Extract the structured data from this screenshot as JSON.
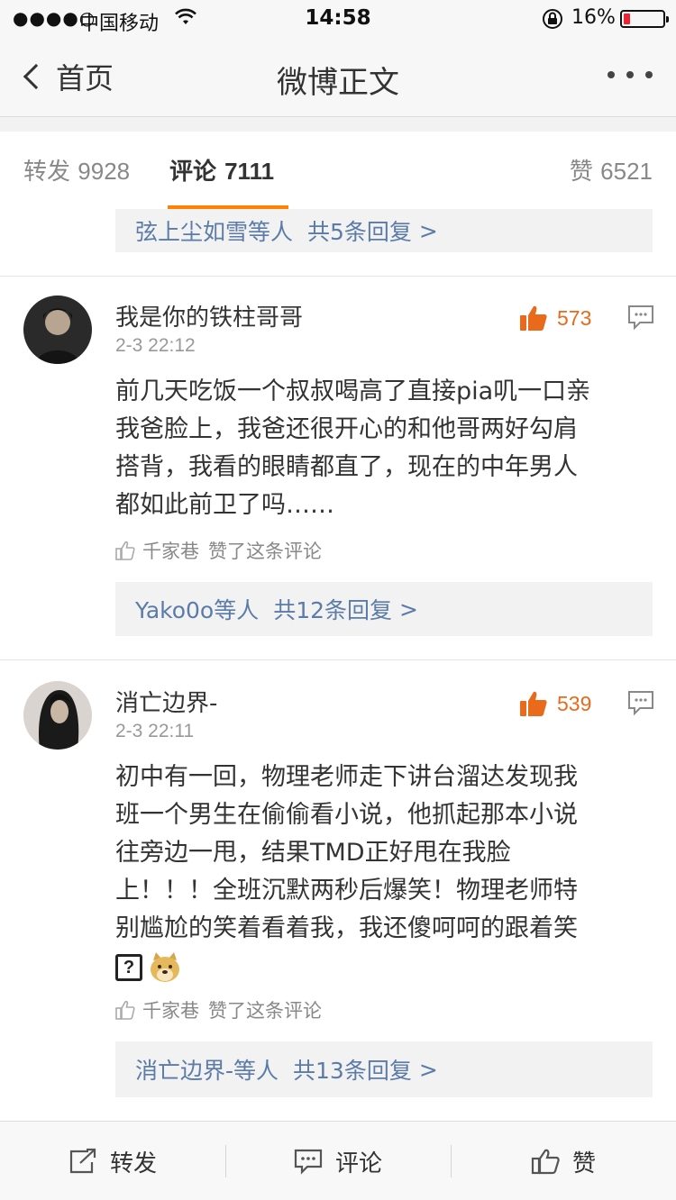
{
  "status_bar": {
    "signal": "●●●●○",
    "carrier": "中国移动",
    "time": "14:58",
    "battery": "16%",
    "battery_level": 0.16
  },
  "nav": {
    "back_label": "首页",
    "title": "微博正文"
  },
  "tabs": {
    "reposts": {
      "label": "转发",
      "count": "9928"
    },
    "comments": {
      "label": "评论",
      "count": "7111"
    },
    "likes": {
      "label": "赞",
      "count": "6521"
    }
  },
  "top_reply_box": {
    "users": "弦上尘如雪等人",
    "count": "共5条回复",
    "arrow": ">"
  },
  "comments": [
    {
      "username": "我是你的铁柱哥哥",
      "time": "2-3 22:12",
      "likes": "573",
      "text_lines": [
        "前几天吃饭一个叔叔喝高了直接pia叽一口亲",
        "我爸脸上，我爸还很开心的和他哥两好勾肩",
        "搭背，我看的眼睛都直了，现在的中年男人",
        "都如此前卫了吗……"
      ],
      "liked_by": {
        "name": "千家巷",
        "action": "赞了这条评论"
      },
      "reply_box": {
        "users": "Yako0o等人",
        "count": "共12条回复",
        "arrow": ">"
      }
    },
    {
      "username": "消亡边界-",
      "time": "2-3 22:11",
      "likes": "539",
      "text_lines": [
        "初中有一回，物理老师走下讲台溜达发现我",
        "班一个男生在偷偷看小说，他抓起那本小说",
        "往旁边一甩，结果TMD正好甩在我脸",
        "上！！！全班沉默两秒后爆笑！物理老师特",
        "别尴尬的笑着看着我，我还傻呵呵的跟着笑"
      ],
      "emoji_question": "?",
      "liked_by": {
        "name": "千家巷",
        "action": "赞了这条评论"
      },
      "reply_box": {
        "users": "消亡边界-等人",
        "count": "共13条回复",
        "arrow": ">"
      }
    }
  ],
  "toolbar": {
    "repost_label": "转发",
    "comment_label": "评论",
    "like_label": "赞"
  },
  "colors": {
    "accent": "#ff8200",
    "like": "#e86a1a",
    "link": "#5b7ba8"
  }
}
